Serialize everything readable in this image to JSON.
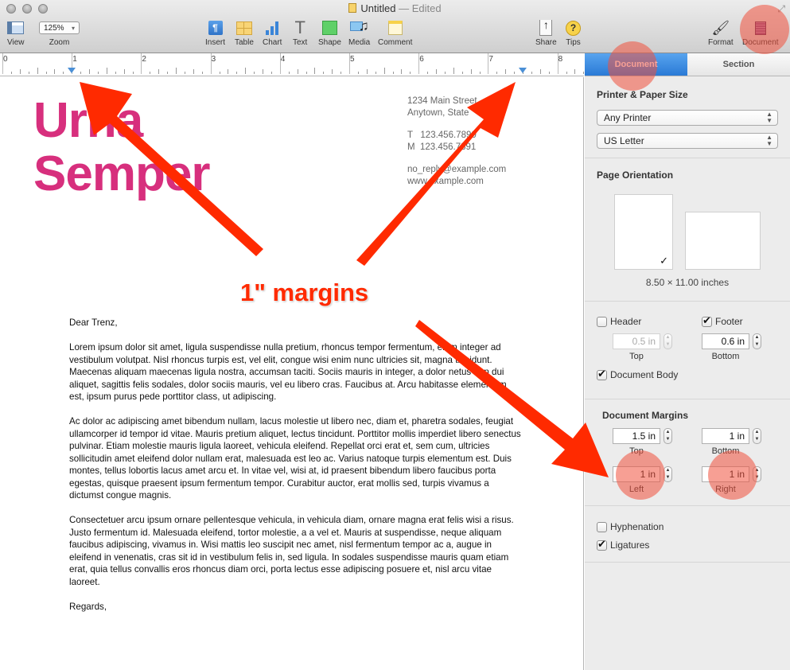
{
  "window": {
    "title": "Untitled",
    "status": "— Edited"
  },
  "toolbar": {
    "view_label": "View",
    "zoom_value": "125%",
    "zoom_label": "Zoom",
    "insert_label": "Insert",
    "table_label": "Table",
    "chart_label": "Chart",
    "text_label": "Text",
    "shape_label": "Shape",
    "media_label": "Media",
    "comment_label": "Comment",
    "share_label": "Share",
    "tips_label": "Tips",
    "format_label": "Format",
    "document_label": "Document",
    "insert_glyph": "¶",
    "text_glyph": "T",
    "share_glyph": "↑",
    "tips_glyph": "?",
    "format_glyph": "🖌",
    "media_glyph": "♫",
    "zoom_arrow": "▾",
    "fullscreen_glyph": "⤢"
  },
  "ruler": {
    "units": "inches",
    "labels": [
      "0",
      "1",
      "2",
      "3",
      "4",
      "5",
      "6",
      "7",
      "8"
    ],
    "left_margin_in": 1,
    "right_margin_in": 7.5
  },
  "document": {
    "name_line1": "Urna",
    "name_line2": "Semper",
    "address_line1": "1234 Main Street",
    "address_line2": "Anytown, State",
    "phone_t": "T   123.456.7890",
    "phone_m": "M  123.456.7891",
    "email": "no_reply@example.com",
    "website": "www.example.com",
    "salutation": "Dear Trenz,",
    "paragraphs": [
      "Lorem ipsum dolor sit amet, ligula suspendisse nulla pretium, rhoncus tempor fermentum, enim integer ad vestibulum volutpat. Nisl rhoncus turpis est, vel elit, congue wisi enim nunc ultricies sit, magna tincidunt. Maecenas aliquam maecenas ligula nostra, accumsan taciti. Sociis mauris in integer, a dolor netus non dui aliquet, sagittis felis sodales, dolor sociis mauris, vel eu libero cras. Faucibus at. Arcu habitasse elementum est, ipsum purus pede porttitor class, ut adipiscing.",
      "Ac dolor ac adipiscing amet bibendum nullam, lacus molestie ut libero nec, diam et, pharetra sodales, feugiat ullamcorper id tempor id vitae. Mauris pretium aliquet, lectus tincidunt. Porttitor mollis imperdiet libero senectus pulvinar. Etiam molestie mauris ligula laoreet, vehicula eleifend. Repellat orci erat et, sem cum, ultricies sollicitudin amet eleifend dolor nullam erat, malesuada est leo ac. Varius natoque turpis elementum est. Duis montes, tellus lobortis lacus amet arcu et. In vitae vel, wisi at, id praesent bibendum libero faucibus porta egestas, quisque praesent ipsum fermentum tempor. Curabitur auctor, erat mollis sed, turpis vivamus a dictumst congue magnis.",
      "Consectetuer arcu ipsum ornare pellentesque vehicula, in vehicula diam, ornare magna erat felis wisi a risus. Justo fermentum id. Malesuada eleifend, tortor molestie, a a vel et. Mauris at suspendisse, neque aliquam faucibus adipiscing, vivamus in. Wisi mattis leo suscipit nec amet, nisl fermentum tempor ac a, augue in eleifend in venenatis, cras sit id in vestibulum felis in, sed ligula. In sodales suspendisse mauris quam etiam erat, quia tellus convallis eros rhoncus diam orci, porta lectus esse adipiscing posuere et, nisl arcu vitae laoreet."
    ],
    "closing": "Regards,",
    "name_color": "#d72f7d"
  },
  "inspector": {
    "tabs": [
      {
        "label": "Document",
        "active": true
      },
      {
        "label": "Section",
        "active": false
      }
    ],
    "printer_section_title": "Printer & Paper Size",
    "printer_value": "Any Printer",
    "paper_value": "US Letter",
    "orientation_title": "Page Orientation",
    "orientation_selected": "portrait",
    "check_glyph": "✓",
    "paper_dimensions": "8.50 × 11.00 inches",
    "header": {
      "label": "Header",
      "checked": false,
      "value": "0.5 in",
      "sublabel": "Top"
    },
    "footer": {
      "label": "Footer",
      "checked": true,
      "value": "0.6 in",
      "sublabel": "Bottom"
    },
    "document_body": {
      "label": "Document Body",
      "checked": true
    },
    "margins_title": "Document Margins",
    "margins": {
      "top": {
        "value": "1.5 in",
        "label": "Top"
      },
      "bottom": {
        "value": "1 in",
        "label": "Bottom"
      },
      "left": {
        "value": "1 in",
        "label": "Left"
      },
      "right": {
        "value": "1 in",
        "label": "Right"
      }
    },
    "hyphenation": {
      "label": "Hyphenation",
      "checked": false
    },
    "ligatures": {
      "label": "Ligatures",
      "checked": true
    },
    "stepper_glyph": "▲▼"
  },
  "annotation": {
    "callout_text": "1\" margins",
    "arrow_color": "#ff2a00",
    "highlight_color": "#f0503c"
  },
  "colors": {
    "accent_blue": "#2a7ad6",
    "toolbar_bg": "#dcdcdc",
    "inspector_bg": "#ececec"
  }
}
